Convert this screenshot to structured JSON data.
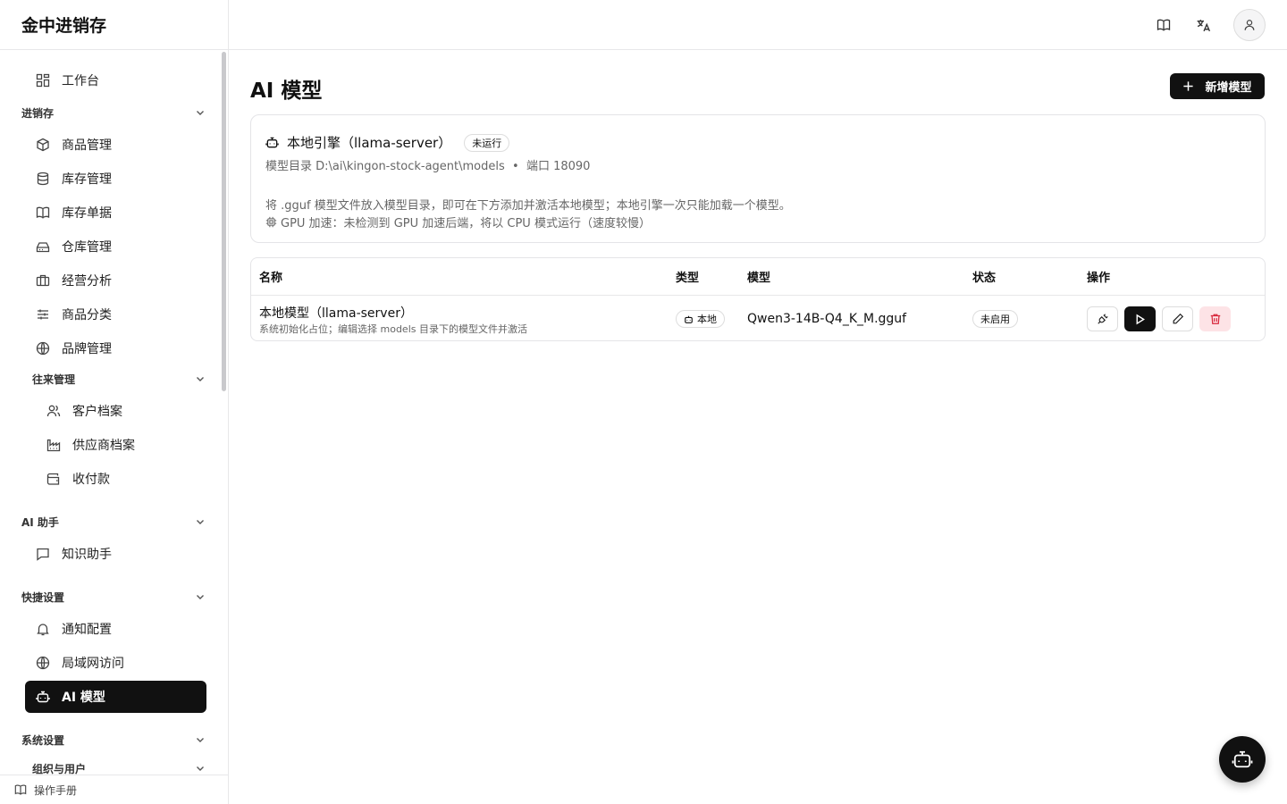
{
  "app": {
    "brand": "金中进销存"
  },
  "sidebar": {
    "workbench": "工作台",
    "group_inventory": "进销存",
    "items_inventory": [
      "商品管理",
      "库存管理",
      "库存单据",
      "仓库管理",
      "经营分析",
      "商品分类",
      "品牌管理"
    ],
    "group_partners": "往来管理",
    "items_partners": [
      "客户档案",
      "供应商档案",
      "收付款"
    ],
    "group_ai": "AI 助手",
    "items_ai": [
      "知识助手"
    ],
    "group_quick": "快捷设置",
    "items_quick": [
      "通知配置",
      "局域网访问",
      "AI 模型"
    ],
    "group_system": "系统设置",
    "group_org": "组织与用户",
    "manual": "操作手册",
    "active_item": "AI 模型"
  },
  "page": {
    "title": "AI 模型",
    "add_button": "新增模型"
  },
  "engine": {
    "title": "本地引擎（llama-server）",
    "status": "未运行",
    "meta": "模型目录 D:\\ai\\kingon-stock-agent\\models  •  端口 18090",
    "note": "将 .gguf 模型文件放入模型目录，即可在下方添加并激活本地模型；本地引擎一次只能加载一个模型。",
    "gpu": "GPU 加速：未检测到 GPU 加速后端，将以 CPU 模式运行（速度较慢）"
  },
  "table": {
    "headers": [
      "名称",
      "类型",
      "模型",
      "状态",
      "操作"
    ],
    "rows": [
      {
        "name": "本地模型（llama-server）",
        "desc": "系统初始化占位；编辑选择 models 目录下的模型文件并激活",
        "type": "本地",
        "model": "Qwen3-14B-Q4_K_M.gguf",
        "status": "未启用"
      }
    ]
  },
  "colors": {
    "primary": "#111111",
    "border": "#e4e4e7",
    "danger": "#d8263b",
    "danger_bg": "#fde3e6",
    "muted_text": "#666666"
  }
}
